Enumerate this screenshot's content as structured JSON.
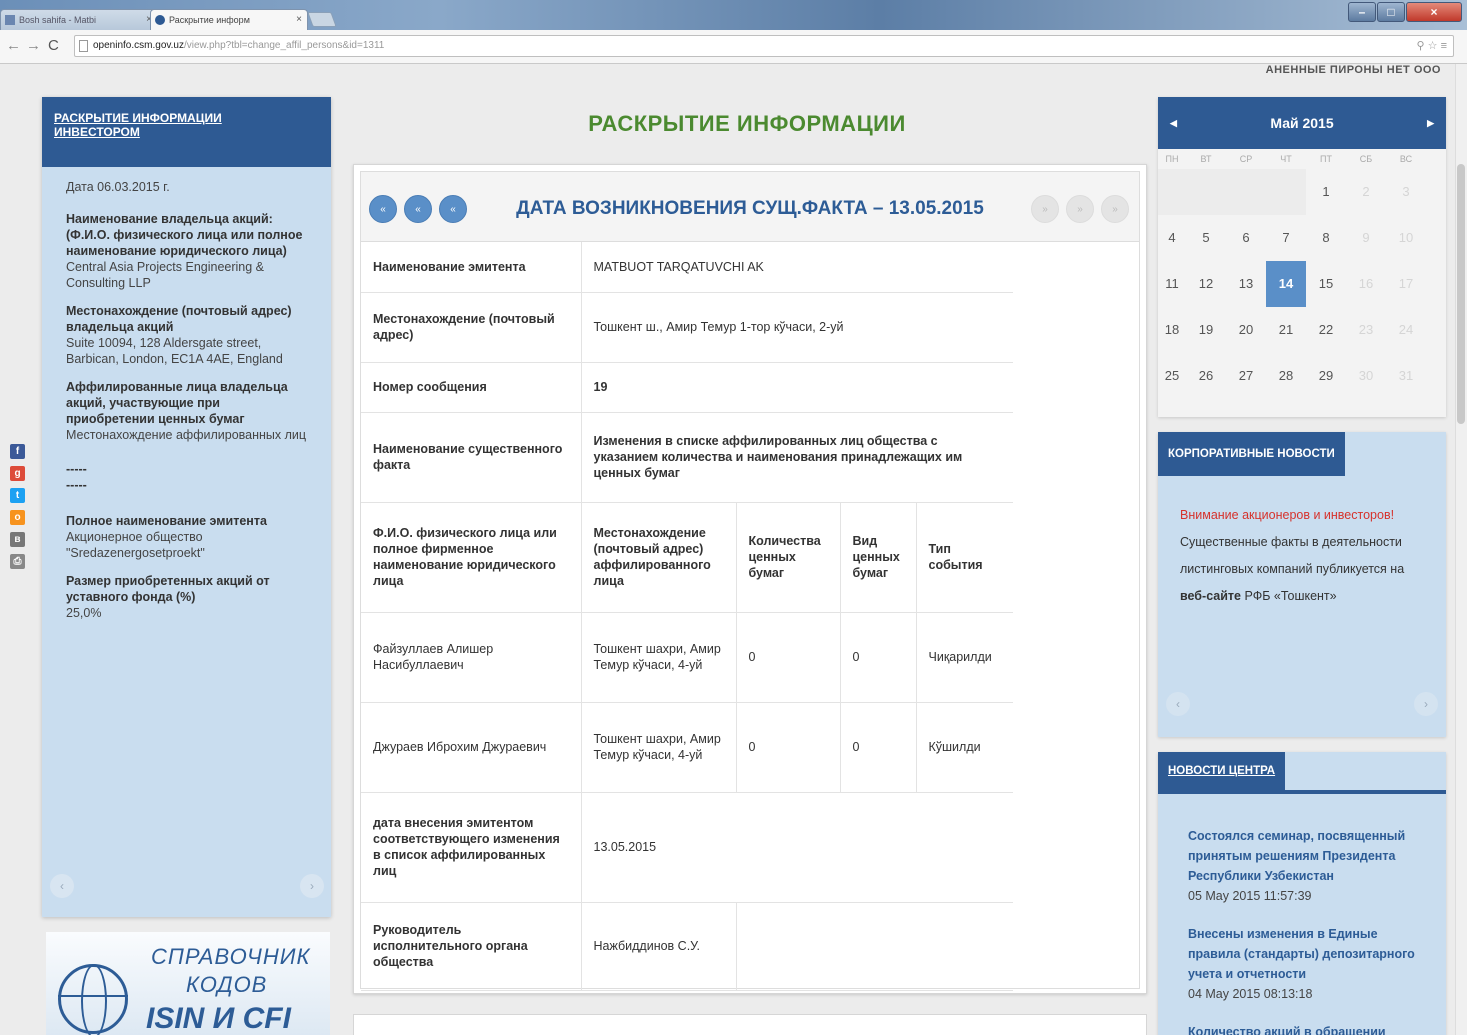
{
  "browser": {
    "tabs": [
      {
        "label": "Bosh sahifa - Matbi",
        "active": false
      },
      {
        "label": "Раскрытие информ",
        "active": true
      }
    ],
    "url_host": "openinfo.csm.gov.uz",
    "url_path": "/view.php?tbl=change_affil_persons&id=1311"
  },
  "header": {
    "top_text": "АНЕННЫЕ ПИРОНЫ НЕТ ООО"
  },
  "left_panel": {
    "title": "РАСКРЫТИЕ ИНФОРМАЦИИ ИНВЕСТОРОМ",
    "date": "Дата 06.03.2015 г.",
    "owner_label": "Наименование владельца акций: (Ф.И.О. физического лица или полное наименование юридического лица)",
    "owner_value": "Central Asia Projects Engineering & Consulting LLP",
    "address_label": "Местонахождение (почтовый адрес) владельца акций",
    "address_value": "Suite 10094, 128 Aldersgate street, Barbican, London, EC1A 4AE, England",
    "affil_label": "Аффилированные лица владельца акций, участвующие при приобретении ценных бумаг",
    "affil_value": "Местонахождение аффилированных лиц",
    "dash1": "-----",
    "dash2": "-----",
    "emitent_label": "Полное наименование эмитента",
    "emitent_value": "Акционерное общество \"Sredazenergosetproekt\"",
    "share_label": "Размер приобретенных акций от уставного фонда (%)",
    "share_value": "25,0%",
    "prev": "‹",
    "next": "›"
  },
  "isin_banner": {
    "line1": "СПРАВОЧНИК",
    "line2": "КОДОВ",
    "line3": "ISIN И CFI"
  },
  "main": {
    "title": "РАСКРЫТИЕ ИНФОРМАЦИИ",
    "nav_left": [
      "«",
      "«",
      "«"
    ],
    "nav_right": [
      "»",
      "»",
      "»"
    ],
    "fact_date": "ДАТА ВОЗНИКНОВЕНИЯ СУЩ.ФАКТА – 13.05.2015",
    "rows": {
      "emitent_label": "Наименование эмитента",
      "emitent_value": "MATBUOT TARQATUVCHI AK",
      "location_label": "Местонахождение (почтовый адрес)",
      "location_value": "Тошкент ш., Амир Темур 1-тор кўчаси, 2-уй",
      "msg_label": "Номер сообщения",
      "msg_value": "19",
      "fact_label": "Наименование существенного факта",
      "fact_value": "Изменения в списке аффилированных лиц общества с указанием количества и наименования принадлежащих им ценных бумаг",
      "date_label": "дата внесения эмитентом соответствующего изменения в список аффилированных лиц",
      "date_value": "13.05.2015",
      "head_label": "Руководитель исполнительного органа общества",
      "head_value": "Нажбиддинов С.У."
    },
    "affil_table": {
      "headers": [
        "Ф.И.О. физического лица или полное фирменное наименование юридического лица",
        "Местонахождение (почтовый адрес) аффилированного лица",
        "Количества ценных бумаг",
        "Вид ценных бумаг",
        "Тип события"
      ],
      "rows": [
        [
          "Файзуллаев Алишер Насибуллаевич",
          "Тошкент шахри, Амир Темур кўчаси, 4-уй",
          "0",
          "0",
          "Чиқарилди"
        ],
        [
          "Джураев Иброхим Джураевич",
          "Тошкент шахри, Амир Темур кўчаси, 4-уй",
          "0",
          "0",
          "Кўшилди"
        ]
      ]
    }
  },
  "calendar": {
    "month": "Май 2015",
    "weekdays": [
      "ПН",
      "ВТ",
      "СР",
      "ЧТ",
      "ПТ",
      "СБ",
      "ВС"
    ],
    "weeks": [
      [
        "",
        "",
        "",
        "",
        "1",
        "2",
        "3"
      ],
      [
        "4",
        "5",
        "6",
        "7",
        "8",
        "9",
        "10"
      ],
      [
        "11",
        "12",
        "13",
        "14",
        "15",
        "16",
        "17"
      ],
      [
        "18",
        "19",
        "20",
        "21",
        "22",
        "23",
        "24"
      ],
      [
        "25",
        "26",
        "27",
        "28",
        "29",
        "30",
        "31"
      ]
    ],
    "today": "14"
  },
  "corp_news": {
    "title": "КОРПОРАТИВНЫЕ НОВОСТИ",
    "red_text": "Внимание акционеров и инвесторов!",
    "text": "Существенные факты в деятельности листинговых компаний публикуется на",
    "bold_text": "веб-сайте",
    "tail": "РФБ «Тошкент»",
    "prev": "‹",
    "next": "›"
  },
  "center_news": {
    "title": "НОВОСТИ ЦЕНТРА",
    "items": [
      {
        "title": "Состоялся семинар, посвященный принятым решениям Президента Республики Узбекистан",
        "date": "05 May 2015 11:57:39"
      },
      {
        "title": "Внесены изменения в Единые правила (стандарты) депозитарного учета и отчетности",
        "date": "04 May 2015 08:13:18"
      },
      {
        "title": "Количество акций в обращении",
        "date": ""
      }
    ]
  },
  "colors": {
    "brand_blue": "#2e5a93",
    "title_green": "#4b8a30",
    "today_blue": "#5a8fc8",
    "alert_red": "#d6322c"
  },
  "social_icons": [
    "facebook-icon",
    "google-plus-icon",
    "twitter-icon",
    "odnoklassniki-icon",
    "vk-icon",
    "print-icon"
  ]
}
